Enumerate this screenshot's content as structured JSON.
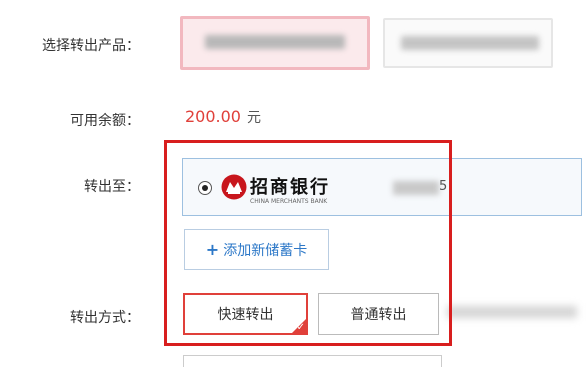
{
  "labels": {
    "product": "选择转出产品：",
    "balance": "可用余额：",
    "transfer_to": "转出至：",
    "method": "转出方式："
  },
  "balance": {
    "amount": "200.00",
    "unit": "元"
  },
  "bank_card": {
    "selected": true,
    "bank_name": "招商银行",
    "bank_name_en": "CHINA MERCHANTS BANK",
    "card_tail": "5"
  },
  "add_card": {
    "icon": "plus-icon",
    "label": "添加新储蓄卡"
  },
  "methods": {
    "fast": "快速转出",
    "normal": "普通转出",
    "selected": "fast"
  },
  "colors": {
    "accent_red": "#e0403a",
    "highlight_frame": "#d81e1e",
    "link_blue": "#2d78c8"
  }
}
